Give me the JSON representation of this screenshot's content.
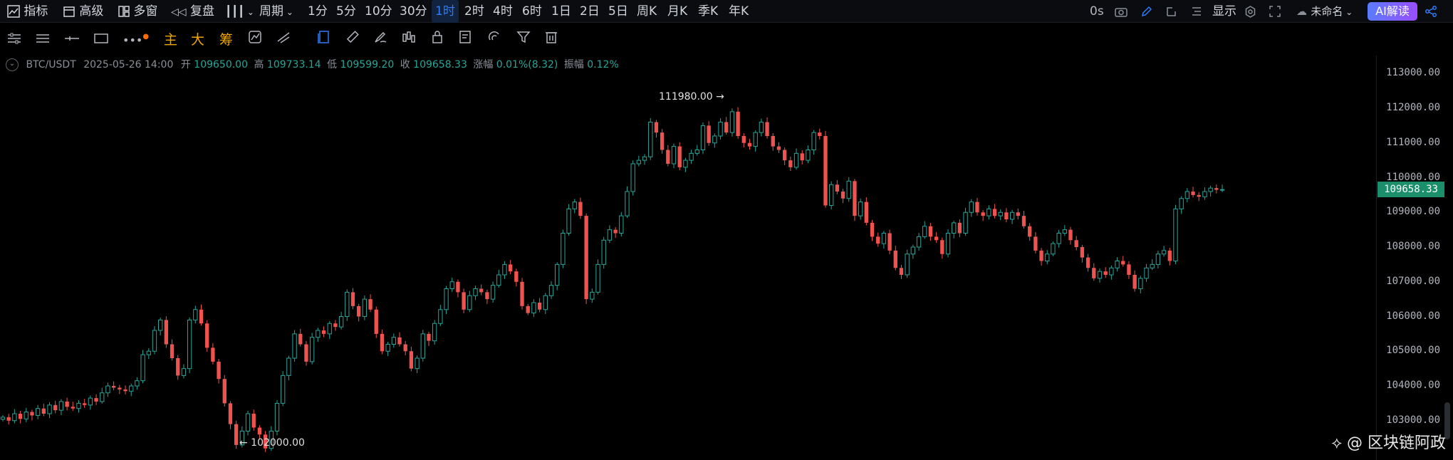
{
  "topbar": {
    "indicators": "指标",
    "advanced": "高级",
    "multi_window": "多窗",
    "replay": "复盘",
    "period": "周期",
    "intervals": [
      "1分",
      "5分",
      "10分",
      "30分",
      "1时",
      "2时",
      "4时",
      "6时",
      "1日",
      "2日",
      "5日",
      "周K",
      "月K",
      "季K",
      "年K"
    ],
    "active_interval": "1时",
    "countdown": "0s",
    "display": "显示",
    "layout_name": "未命名",
    "ai_button": "AI解读"
  },
  "drawing_tools": {
    "main": "主",
    "big": "大",
    "chips": "筹"
  },
  "info": {
    "symbol": "BTC/USDT",
    "datetime": "2025-05-26 14:00",
    "open_label": "开",
    "open": "109650.00",
    "high_label": "高",
    "high": "109733.14",
    "low_label": "低",
    "low": "109599.20",
    "close_label": "收",
    "close": "109658.33",
    "change_label": "涨幅",
    "change": "0.01%(8.32)",
    "amplitude_label": "振幅",
    "amplitude": "0.12%"
  },
  "annotations": {
    "max": "111980.00 →",
    "min": "← 102000.00"
  },
  "current_price": "109658.33",
  "watermark": "@ 区块链阿政",
  "colors": {
    "up": "#26a69a",
    "down": "#ef5350",
    "accent": "#2f7cf6"
  },
  "chart_data": {
    "type": "candlestick",
    "symbol": "BTC/USDT",
    "interval": "1h",
    "ylim": [
      102600,
      113400
    ],
    "yticks": [
      "113000.00",
      "112000.00",
      "111000.00",
      "110000.00",
      "109000.00",
      "108000.00",
      "107000.00",
      "106000.00",
      "105000.00",
      "104000.00",
      "103000.00"
    ],
    "max_marker": 111980.0,
    "min_marker": 102000.0,
    "last": 109658.33,
    "closes": [
      103100,
      103000,
      103200,
      103050,
      103250,
      103150,
      103350,
      103200,
      103450,
      103300,
      103550,
      103400,
      103350,
      103500,
      103450,
      103650,
      103550,
      103800,
      104000,
      103950,
      103900,
      103850,
      104000,
      104150,
      104900,
      105000,
      105600,
      105900,
      105200,
      104800,
      104300,
      104500,
      105900,
      106200,
      105800,
      105100,
      104700,
      104200,
      103500,
      102900,
      102300,
      102700,
      103200,
      102800,
      102600,
      102200,
      102700,
      103500,
      104300,
      104800,
      105500,
      105200,
      104700,
      105400,
      105600,
      105500,
      105800,
      105700,
      106000,
      106700,
      106300,
      106000,
      106500,
      106200,
      105500,
      105000,
      105200,
      105400,
      105200,
      105000,
      104500,
      104800,
      105500,
      105300,
      105800,
      106200,
      106800,
      107000,
      106700,
      106200,
      106600,
      106800,
      106700,
      106500,
      106900,
      107200,
      107500,
      107300,
      107000,
      106300,
      106100,
      106400,
      106200,
      106600,
      106900,
      107500,
      108400,
      109100,
      109300,
      108900,
      106500,
      106700,
      107500,
      108200,
      108500,
      108400,
      108900,
      109600,
      110400,
      110500,
      110600,
      111600,
      111300,
      110800,
      110400,
      110900,
      110300,
      110500,
      110700,
      110800,
      111500,
      111000,
      111200,
      111600,
      111300,
      111900,
      111200,
      111000,
      110900,
      111300,
      111600,
      111200,
      110900,
      110800,
      110500,
      110300,
      110700,
      110500,
      110800,
      111300,
      111200,
      109200,
      109800,
      109600,
      109400,
      109900,
      108900,
      109300,
      108700,
      108300,
      108100,
      108400,
      107900,
      107400,
      107200,
      107800,
      108000,
      108300,
      108600,
      108300,
      108200,
      107800,
      108400,
      108700,
      108400,
      109000,
      109300,
      109000,
      108900,
      109100,
      108900,
      109000,
      108800,
      109000,
      108900,
      108600,
      108300,
      107900,
      107600,
      107800,
      108100,
      108400,
      108500,
      108200,
      108000,
      107700,
      107400,
      107100,
      107300,
      107200,
      107400,
      107600,
      107500,
      107200,
      106800,
      107100,
      107400,
      107500,
      107800,
      107900,
      107600,
      109100,
      109400,
      109600,
      109500,
      109450,
      109600,
      109700,
      109650,
      109658
    ]
  }
}
